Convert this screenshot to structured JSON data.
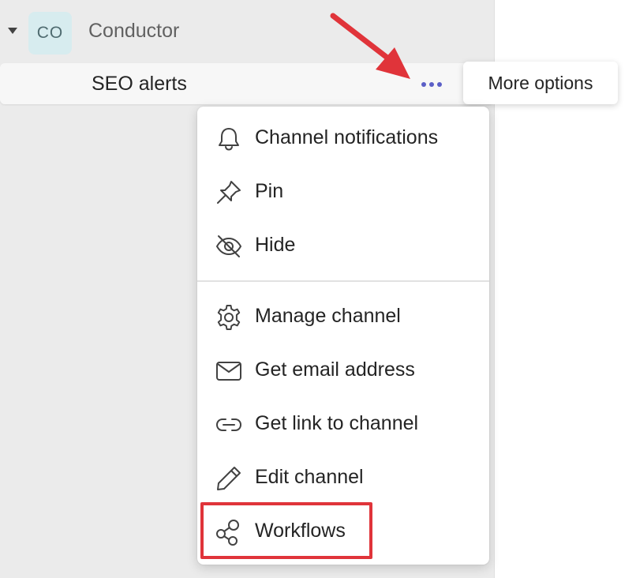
{
  "team": {
    "avatar_text": "CO",
    "name": "Conductor"
  },
  "channel": {
    "name": "SEO alerts"
  },
  "tooltip": {
    "text": "More options"
  },
  "menu": {
    "items": [
      {
        "label": "Channel notifications",
        "icon": "bell-icon"
      },
      {
        "label": "Pin",
        "icon": "pin-icon"
      },
      {
        "label": "Hide",
        "icon": "eye-off-icon"
      },
      {
        "label": "Manage channel",
        "icon": "gear-icon"
      },
      {
        "label": "Get email address",
        "icon": "mail-icon"
      },
      {
        "label": "Get link to channel",
        "icon": "link-icon"
      },
      {
        "label": "Edit channel",
        "icon": "pencil-icon"
      },
      {
        "label": "Workflows",
        "icon": "workflow-icon"
      }
    ]
  },
  "colors": {
    "accent": "#5b5fc7",
    "annotation_red": "#e0343a",
    "sidebar_bg": "#ebebeb"
  }
}
